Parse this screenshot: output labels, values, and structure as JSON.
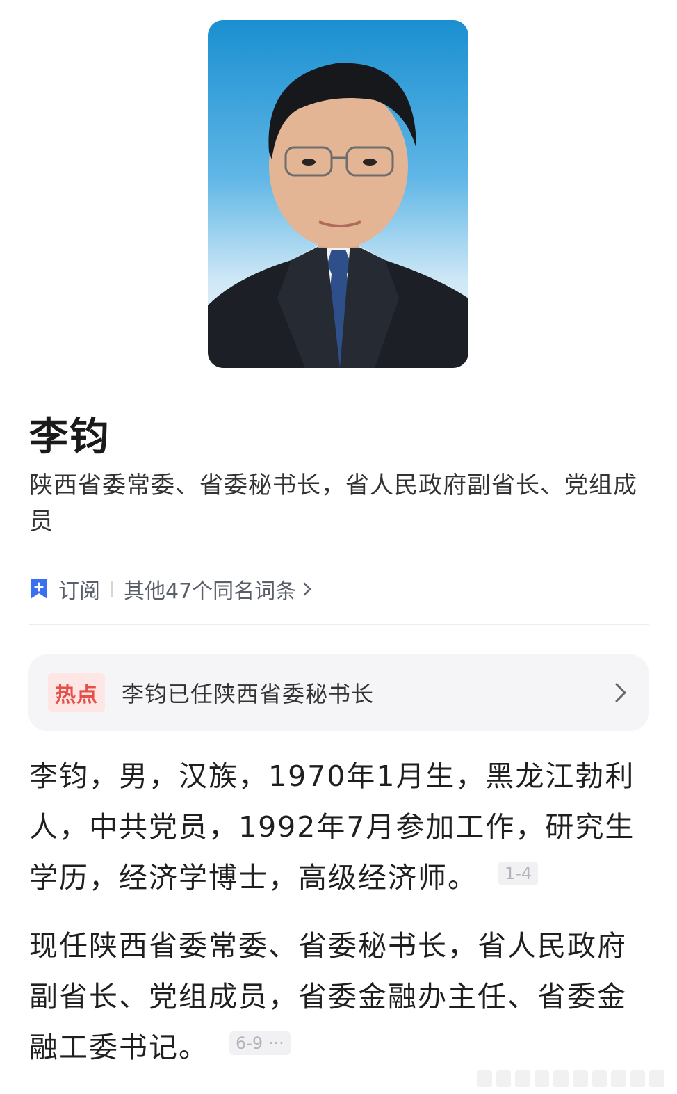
{
  "person": {
    "name": "李钧",
    "subtitle": "陕西省委常委、省委秘书长，省人民政府副省长、党组成员"
  },
  "actions": {
    "subscribe_label": "订阅",
    "same_name_label": "其他47个同名词条"
  },
  "hot": {
    "badge": "热点",
    "text": "李钧已任陕西省委秘书长"
  },
  "paragraphs": [
    {
      "text": "李钧，男，汉族，1970年1月生，黑龙江勃利人，中共党员，1992年7月参加工作，研究生学历，经济学博士，高级经济师。",
      "ref": "1-4"
    },
    {
      "text": "现任陕西省委常委、省委秘书长，省人民政府副省长、党组成员，省委金融办主任、省委金融工委书记。",
      "ref": "6-9 ···"
    }
  ],
  "colors": {
    "accent_blue": "#3a6ff0",
    "hot_red": "#e5514a",
    "portrait_bg": "#1a8fd0"
  },
  "icons": [
    "bookmark-add-icon",
    "chevron-right-icon"
  ]
}
